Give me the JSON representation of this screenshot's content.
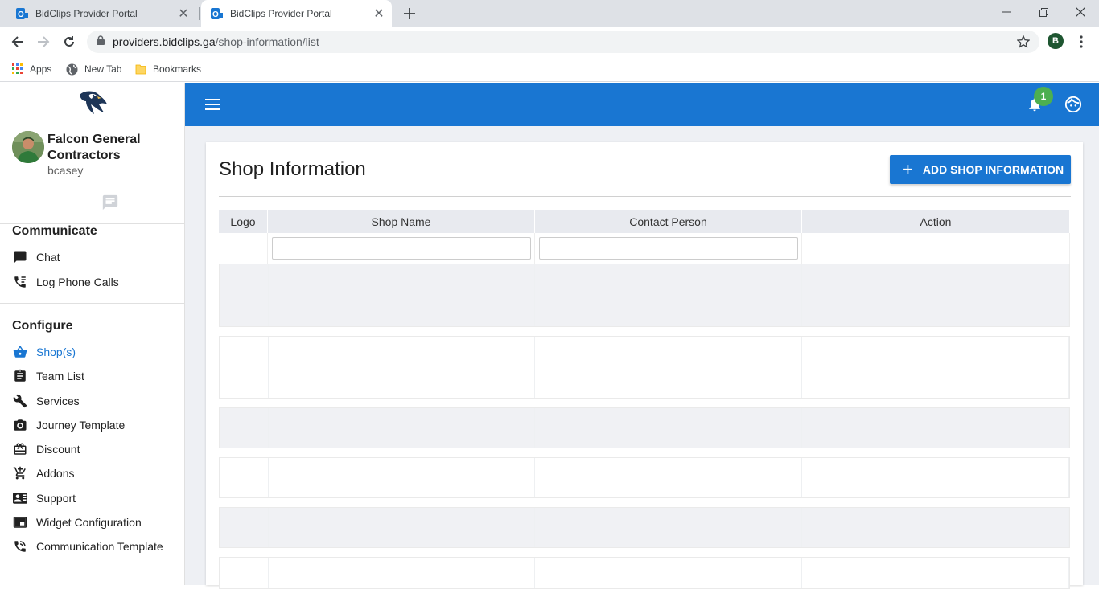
{
  "browser": {
    "tabs": [
      {
        "title": "BidClips Provider Portal",
        "active": false
      },
      {
        "title": "BidClips Provider Portal",
        "active": true
      }
    ],
    "url_host": "providers.bidclips.ga",
    "url_path": "/shop-information/list",
    "profile_initial": "B",
    "bookmarks": [
      {
        "label": "Apps",
        "icon": "apps-grid-icon"
      },
      {
        "label": "New Tab",
        "icon": "globe-icon"
      },
      {
        "label": "Bookmarks",
        "icon": "folder-icon"
      }
    ]
  },
  "sidebar": {
    "company": "Falcon General Contractors",
    "username": "bcasey",
    "sections": [
      {
        "title": "Communicate",
        "items": [
          {
            "label": "Chat",
            "icon": "chat-icon"
          },
          {
            "label": "Log Phone Calls",
            "icon": "phone-log-icon"
          }
        ]
      },
      {
        "title": "Configure",
        "items": [
          {
            "label": "Shop(s)",
            "icon": "basket-icon",
            "active": true
          },
          {
            "label": "Team List",
            "icon": "clipboard-icon"
          },
          {
            "label": "Services",
            "icon": "wrench-icon"
          },
          {
            "label": "Journey Template",
            "icon": "camera-icon"
          },
          {
            "label": "Discount",
            "icon": "gift-icon"
          },
          {
            "label": "Addons",
            "icon": "cart-add-icon"
          },
          {
            "label": "Support",
            "icon": "contact-card-icon"
          },
          {
            "label": "Widget Configuration",
            "icon": "widget-icon"
          },
          {
            "label": "Communication Template",
            "icon": "phone-forward-icon"
          }
        ]
      }
    ]
  },
  "appbar": {
    "notification_count": "1",
    "accent_color": "#1976d2",
    "badge_color": "#4caf50"
  },
  "page": {
    "title": "Shop Information",
    "add_button_label": "ADD SHOP INFORMATION",
    "columns": [
      "Logo",
      "Shop Name",
      "Contact Person",
      "Action"
    ],
    "filters": {
      "shop_name": "",
      "contact_person": ""
    }
  }
}
